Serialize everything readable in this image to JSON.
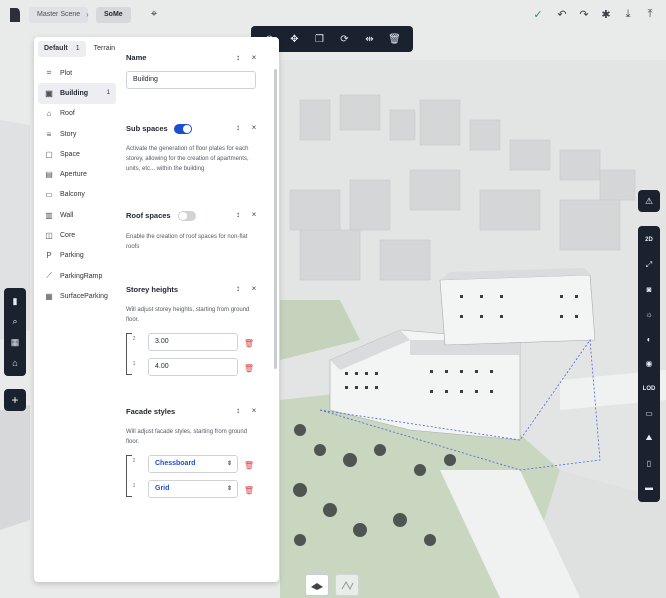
{
  "breadcrumb": {
    "root": "Master Scene",
    "current": "SoMe"
  },
  "panel": {
    "tabs": [
      {
        "label": "Default",
        "count": "1"
      },
      {
        "label": "Terrain",
        "count": ""
      }
    ],
    "nav_items": [
      {
        "label": "Plot",
        "icon": "plot-icon",
        "count": ""
      },
      {
        "label": "Building",
        "icon": "building-icon",
        "count": "1"
      },
      {
        "label": "Roof",
        "icon": "roof-icon",
        "count": ""
      },
      {
        "label": "Story",
        "icon": "story-icon",
        "count": ""
      },
      {
        "label": "Space",
        "icon": "space-icon",
        "count": ""
      },
      {
        "label": "Aperture",
        "icon": "aperture-icon",
        "count": ""
      },
      {
        "label": "Balcony",
        "icon": "balcony-icon",
        "count": ""
      },
      {
        "label": "Wall",
        "icon": "wall-icon",
        "count": ""
      },
      {
        "label": "Core",
        "icon": "core-icon",
        "count": ""
      },
      {
        "label": "Parking",
        "icon": "parking-icon",
        "count": ""
      },
      {
        "label": "ParkingRamp",
        "icon": "parking-ramp-icon",
        "count": ""
      },
      {
        "label": "SurfaceParking",
        "icon": "surface-parking-icon",
        "count": ""
      }
    ],
    "detail": {
      "name_heading": "Name",
      "name_value": "Building",
      "sub_spaces": {
        "heading": "Sub spaces",
        "enabled": true,
        "description": "Activate the generation of floor plates for each storey, allowing for the creation of apartments, units, etc... within the building"
      },
      "roof_spaces": {
        "heading": "Roof spaces",
        "enabled": false,
        "description": "Enable the creation of roof spaces for non-flat roofs"
      },
      "storey_heights": {
        "heading": "Storey heights",
        "description": "Will adjust storey heights, starting from ground floor.",
        "rows": [
          {
            "index": "2",
            "value": "3.00"
          },
          {
            "index": "1",
            "value": "4.00"
          }
        ]
      },
      "facade_styles": {
        "heading": "Facade styles",
        "description": "Will adjust facade styles, starting from ground floor.",
        "rows": [
          {
            "index": "2",
            "value": "Chessboard"
          },
          {
            "index": "1",
            "value": "Grid"
          }
        ]
      },
      "close_glyph": "×",
      "move_glyph": "↕"
    }
  },
  "right_toolbar": {
    "label_2d": "2D",
    "label_lod": "LOD"
  },
  "colors": {
    "toolbar_bg": "#1a2230",
    "accent": "#1b4fd1",
    "danger": "#d64545",
    "grass": "#c9d7c0"
  }
}
